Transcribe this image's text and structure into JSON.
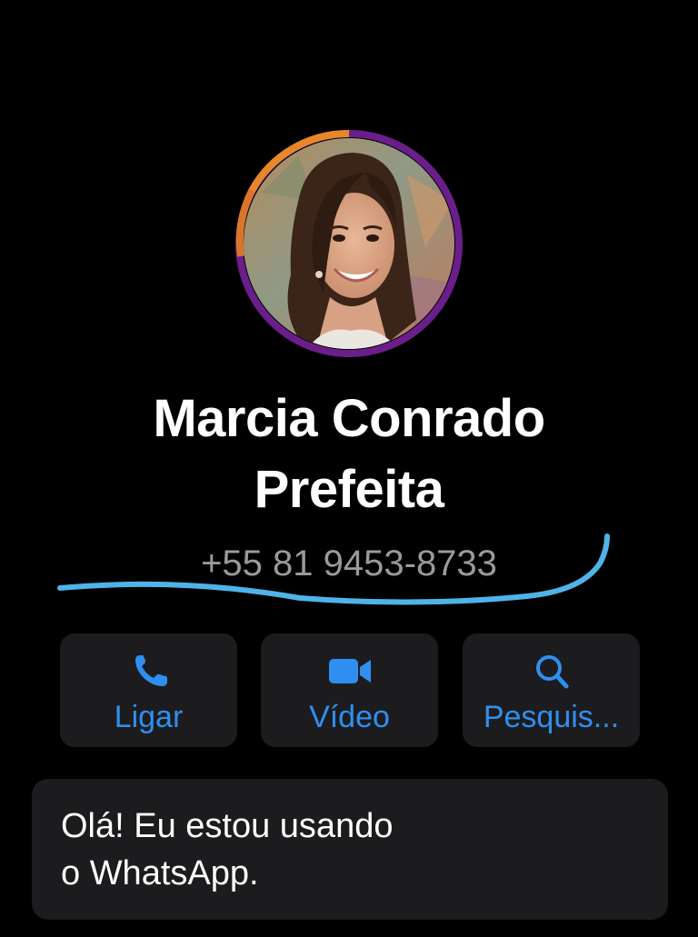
{
  "contact": {
    "name_line1": "Marcia Conrado",
    "name_line2": "Prefeita",
    "phone": "+55 81 9453-8733"
  },
  "actions": [
    {
      "label": "Ligar",
      "icon": "phone-icon"
    },
    {
      "label": "Vídeo",
      "icon": "video-camera-icon"
    },
    {
      "label": "Pesquis...",
      "icon": "search-icon"
    }
  ],
  "status": {
    "line1": "Olá! Eu estou usando",
    "line2": "o WhatsApp."
  },
  "colors": {
    "background": "#000000",
    "card": "#1c1c1e",
    "accent_blue": "#2f8ff0",
    "phone_gray": "#9a9a9a",
    "handwritten_underline": "#4fb3e8",
    "ring_orange": "#e8872a",
    "ring_purple": "#6a1e8a"
  }
}
